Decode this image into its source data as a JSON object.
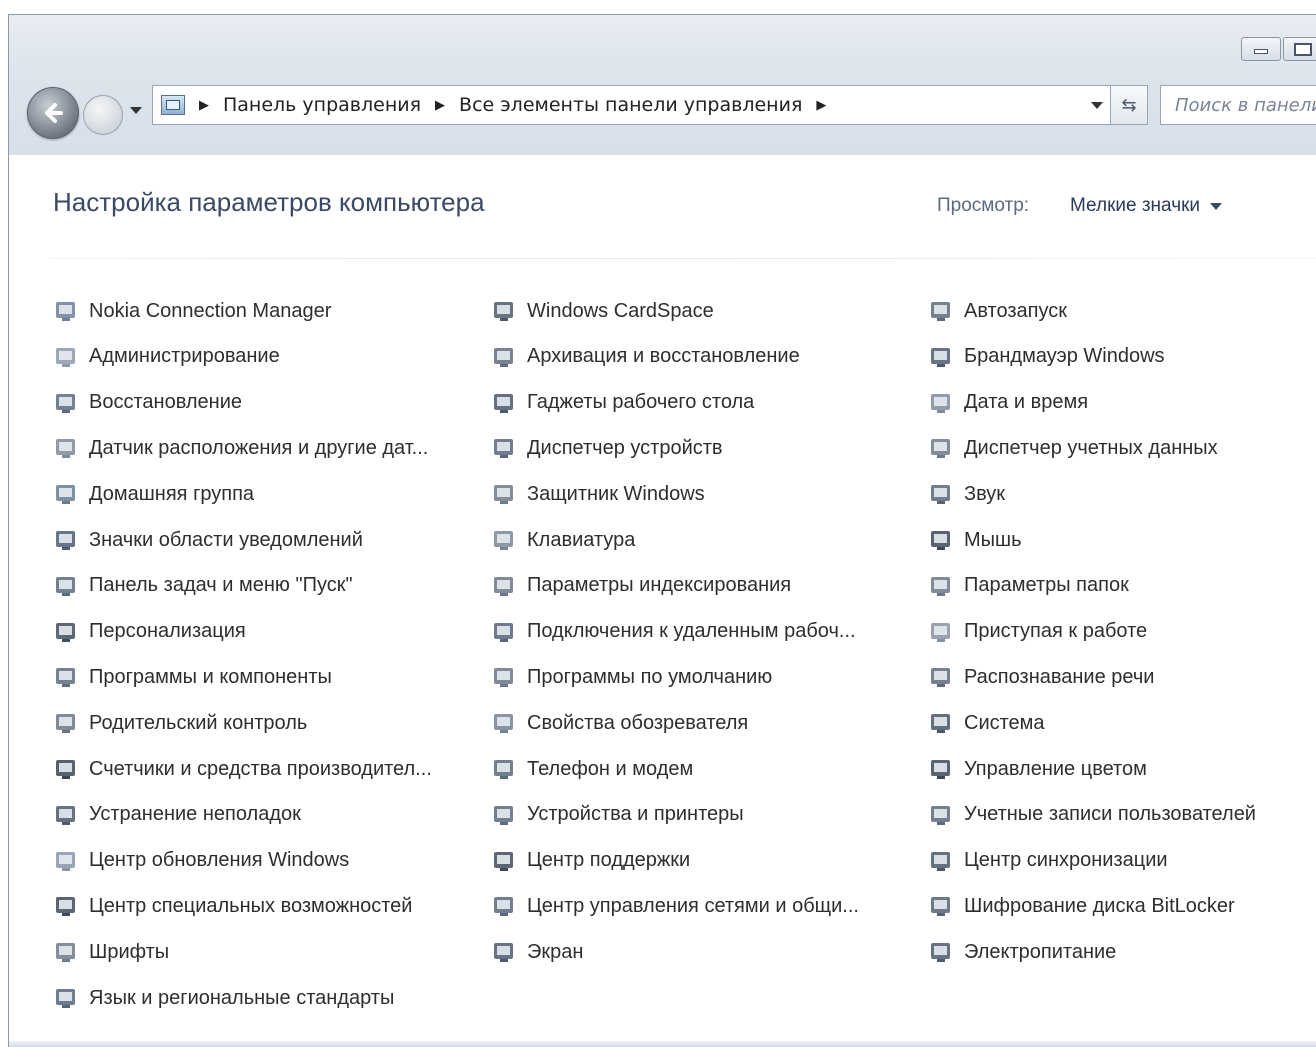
{
  "window": {
    "address": {
      "crumbs": [
        "Панель управления",
        "Все элементы панели управления"
      ]
    },
    "search_placeholder": "Поиск в панели"
  },
  "header": {
    "title": "Настройка параметров компьютера",
    "view_label": "Просмотр:",
    "view_value": "Мелкие значки"
  },
  "columns": [
    [
      {
        "label": "Nokia Connection Manager",
        "icon": "phone-icon",
        "color": "#6d7f99"
      },
      {
        "label": "Администрирование",
        "icon": "admin-tools-icon",
        "color": "#8d9aa8"
      },
      {
        "label": "Восстановление",
        "icon": "recovery-icon",
        "color": "#5b6c80"
      },
      {
        "label": "Датчик расположения и другие дат...",
        "icon": "location-sensor-icon",
        "color": "#7d8a98"
      },
      {
        "label": "Домашняя группа",
        "icon": "homegroup-icon",
        "color": "#6a7c92"
      },
      {
        "label": "Значки области уведомлений",
        "icon": "notification-area-icon",
        "color": "#4d5d72"
      },
      {
        "label": "Панель задач и меню \"Пуск\"",
        "icon": "taskbar-icon",
        "color": "#5a6a7e"
      },
      {
        "label": "Персонализация",
        "icon": "personalization-icon",
        "color": "#3f4d5e"
      },
      {
        "label": "Программы и компоненты",
        "icon": "programs-icon",
        "color": "#5e6c7c"
      },
      {
        "label": "Родительский контроль",
        "icon": "parental-control-icon",
        "color": "#6b7686"
      },
      {
        "label": "Счетчики и средства производител...",
        "icon": "performance-icon",
        "color": "#3a4656"
      },
      {
        "label": "Устранение неполадок",
        "icon": "troubleshooting-icon",
        "color": "#4e5b6c"
      },
      {
        "label": "Центр обновления Windows",
        "icon": "windows-update-icon",
        "color": "#8795a4"
      },
      {
        "label": "Центр специальных возможностей",
        "icon": "ease-of-access-icon",
        "color": "#3e4b5c"
      },
      {
        "label": "Шрифты",
        "icon": "fonts-icon",
        "color": "#6e7b8a"
      },
      {
        "label": "Язык и региональные стандарты",
        "icon": "region-language-icon",
        "color": "#55657a"
      }
    ],
    [
      {
        "label": "Windows CardSpace",
        "icon": "cardspace-icon",
        "color": "#4e5a6a"
      },
      {
        "label": "Архивация и восстановление",
        "icon": "backup-icon",
        "color": "#5f6d7e"
      },
      {
        "label": "Гаджеты рабочего стола",
        "icon": "gadgets-icon",
        "color": "#4b586a"
      },
      {
        "label": "Диспетчер устройств",
        "icon": "device-manager-icon",
        "color": "#596679"
      },
      {
        "label": "Защитник Windows",
        "icon": "defender-icon",
        "color": "#6e7a8a"
      },
      {
        "label": "Клавиатура",
        "icon": "keyboard-icon",
        "color": "#7a8696"
      },
      {
        "label": "Параметры индексирования",
        "icon": "indexing-icon",
        "color": "#6a7789"
      },
      {
        "label": "Подключения к удаленным рабоч...",
        "icon": "remote-desktop-icon",
        "color": "#566478"
      },
      {
        "label": "Программы по умолчанию",
        "icon": "default-programs-icon",
        "color": "#6a7788"
      },
      {
        "label": "Свойства обозревателя",
        "icon": "internet-options-icon",
        "color": "#738194"
      },
      {
        "label": "Телефон и модем",
        "icon": "phone-modem-icon",
        "color": "#5b6878"
      },
      {
        "label": "Устройства и принтеры",
        "icon": "printer-icon",
        "color": "#5c697b"
      },
      {
        "label": "Центр поддержки",
        "icon": "action-center-flag-icon",
        "color": "#3f4b5c"
      },
      {
        "label": "Центр управления сетями и общи...",
        "icon": "network-center-icon",
        "color": "#5a677a"
      },
      {
        "label": "Экран",
        "icon": "display-icon",
        "color": "#4d5b6e"
      }
    ],
    [
      {
        "label": "Автозапуск",
        "icon": "autoplay-icon",
        "color": "#5e6b7c"
      },
      {
        "label": "Брандмауэр Windows",
        "icon": "firewall-icon",
        "color": "#4f5c6e"
      },
      {
        "label": "Дата и время",
        "icon": "date-time-icon",
        "color": "#7f8b9a"
      },
      {
        "label": "Диспетчер учетных данных",
        "icon": "credential-manager-icon",
        "color": "#6e7a8a"
      },
      {
        "label": "Звук",
        "icon": "sound-icon",
        "color": "#5a6676"
      },
      {
        "label": "Мышь",
        "icon": "mouse-icon",
        "color": "#3c4858"
      },
      {
        "label": "Параметры папок",
        "icon": "folder-options-icon",
        "color": "#6b7787"
      },
      {
        "label": "Приступая к работе",
        "icon": "getting-started-icon",
        "color": "#8792a0"
      },
      {
        "label": "Распознавание речи",
        "icon": "microphone-icon",
        "color": "#5f6b7b"
      },
      {
        "label": "Система",
        "icon": "system-icon",
        "color": "#4a5767"
      },
      {
        "label": "Управление цветом",
        "icon": "color-management-icon",
        "color": "#3d4a5b"
      },
      {
        "label": "Учетные записи пользователей",
        "icon": "user-accounts-icon",
        "color": "#5d6a7b"
      },
      {
        "label": "Центр синхронизации",
        "icon": "sync-center-icon",
        "color": "#4b5869"
      },
      {
        "label": "Шифрование диска BitLocker",
        "icon": "bitlocker-icon",
        "color": "#566374"
      },
      {
        "label": "Электропитание",
        "icon": "power-options-icon",
        "color": "#4e5b6c"
      }
    ]
  ]
}
